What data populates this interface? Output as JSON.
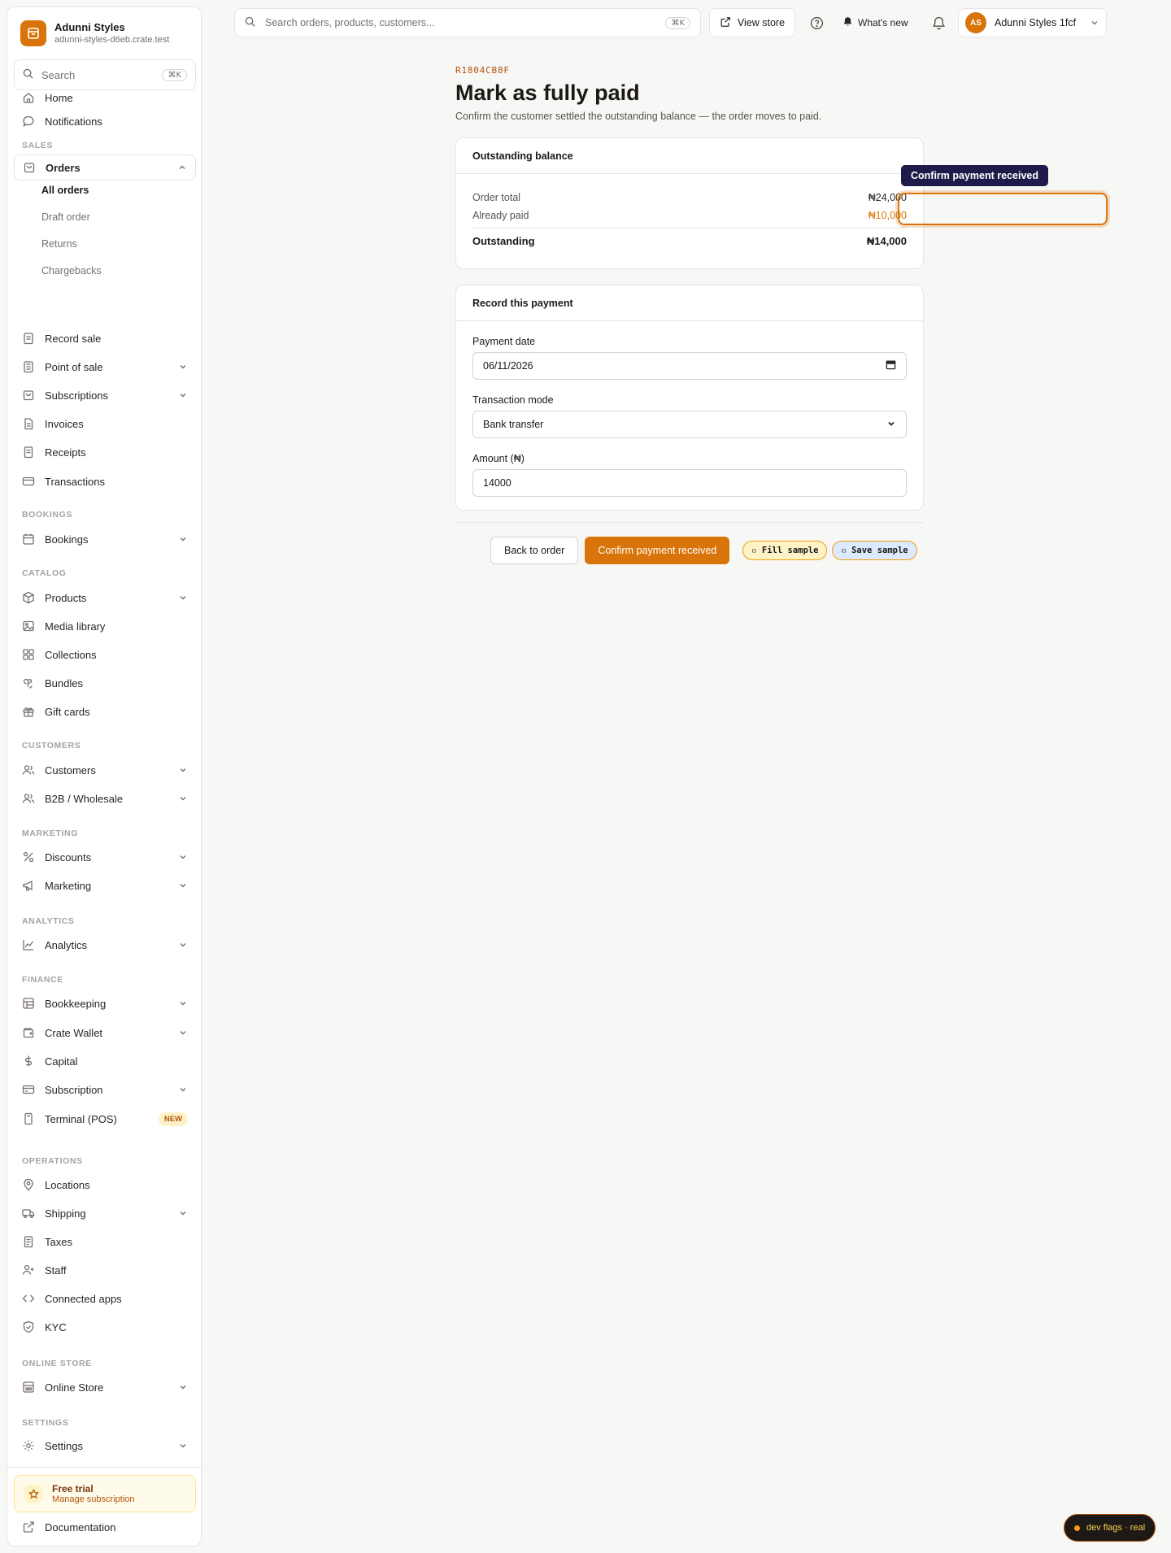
{
  "brand": {
    "name": "Adunni Styles",
    "url": "adunni-styles-d6eb.crate.test"
  },
  "sidebar": {
    "search_label": "Search",
    "search_kbd": "⌘K",
    "home": "Home",
    "notifications": "Notifications",
    "sections": {
      "sales": "SALES",
      "bookings": "BOOKINGS",
      "catalog": "CATALOG",
      "customers": "CUSTOMERS",
      "marketing": "MARKETING",
      "analytics": "ANALYTICS",
      "finance": "FINANCE",
      "operations": "OPERATIONS",
      "online_store": "ONLINE STORE",
      "settings": "SETTINGS"
    },
    "orders": "Orders",
    "orders_sub": [
      "All orders",
      "Draft order",
      "Returns",
      "Chargebacks"
    ],
    "record_sale": "Record sale",
    "point_of_sale": "Point of sale",
    "subscriptions": "Subscriptions",
    "invoices": "Invoices",
    "receipts": "Receipts",
    "transactions": "Transactions",
    "bookings": "Bookings",
    "products": "Products",
    "media_library": "Media library",
    "collections": "Collections",
    "bundles": "Bundles",
    "gift_cards": "Gift cards",
    "customers": "Customers",
    "b2b": "B2B / Wholesale",
    "discounts": "Discounts",
    "marketing": "Marketing",
    "analytics": "Analytics",
    "bookkeeping": "Bookkeeping",
    "crate_wallet": "Crate Wallet",
    "capital": "Capital",
    "subscription": "Subscription",
    "terminal": "Terminal (POS)",
    "terminal_badge": "NEW",
    "locations": "Locations",
    "shipping": "Shipping",
    "taxes": "Taxes",
    "staff": "Staff",
    "connected_apps": "Connected apps",
    "kyc": "KYC",
    "online_store": "Online Store",
    "settings": "Settings",
    "trial_title": "Free trial",
    "trial_sub": "Manage subscription",
    "documentation": "Documentation"
  },
  "topbar": {
    "search_placeholder": "Search orders, products, customers...",
    "search_kbd": "⌘K",
    "view_store": "View store",
    "whats_new": "What's new",
    "avatar_initials": "AS",
    "account_name": "Adunni Styles 1fcf"
  },
  "main": {
    "order_id": "R1804CB8F",
    "title": "Mark as fully paid",
    "subtitle": "Confirm the customer settled the outstanding balance — the order moves to paid.",
    "balance": {
      "heading": "Outstanding balance",
      "order_total_label": "Order total",
      "order_total": "₦24,000",
      "already_paid_label": "Already paid",
      "already_paid": "₦10,000",
      "outstanding_label": "Outstanding",
      "outstanding": "₦14,000"
    },
    "payment": {
      "heading": "Record this payment",
      "date_label": "Payment date",
      "date_value": "06/11/2026",
      "mode_label": "Transaction mode",
      "mode_value": "Bank transfer",
      "amount_label": "Amount (₦)",
      "amount_value": "14000"
    },
    "back_button": "Back to order",
    "confirm_button": "Confirm payment received",
    "fill_sample": "▫ Fill sample",
    "save_sample": "▫ Save sample"
  },
  "overlay": {
    "tooltip": "Confirm payment received"
  },
  "devflags": "dev flags · real",
  "colors": {
    "accent": "#d9740a",
    "tooltip_bg": "#1e1b4b"
  }
}
